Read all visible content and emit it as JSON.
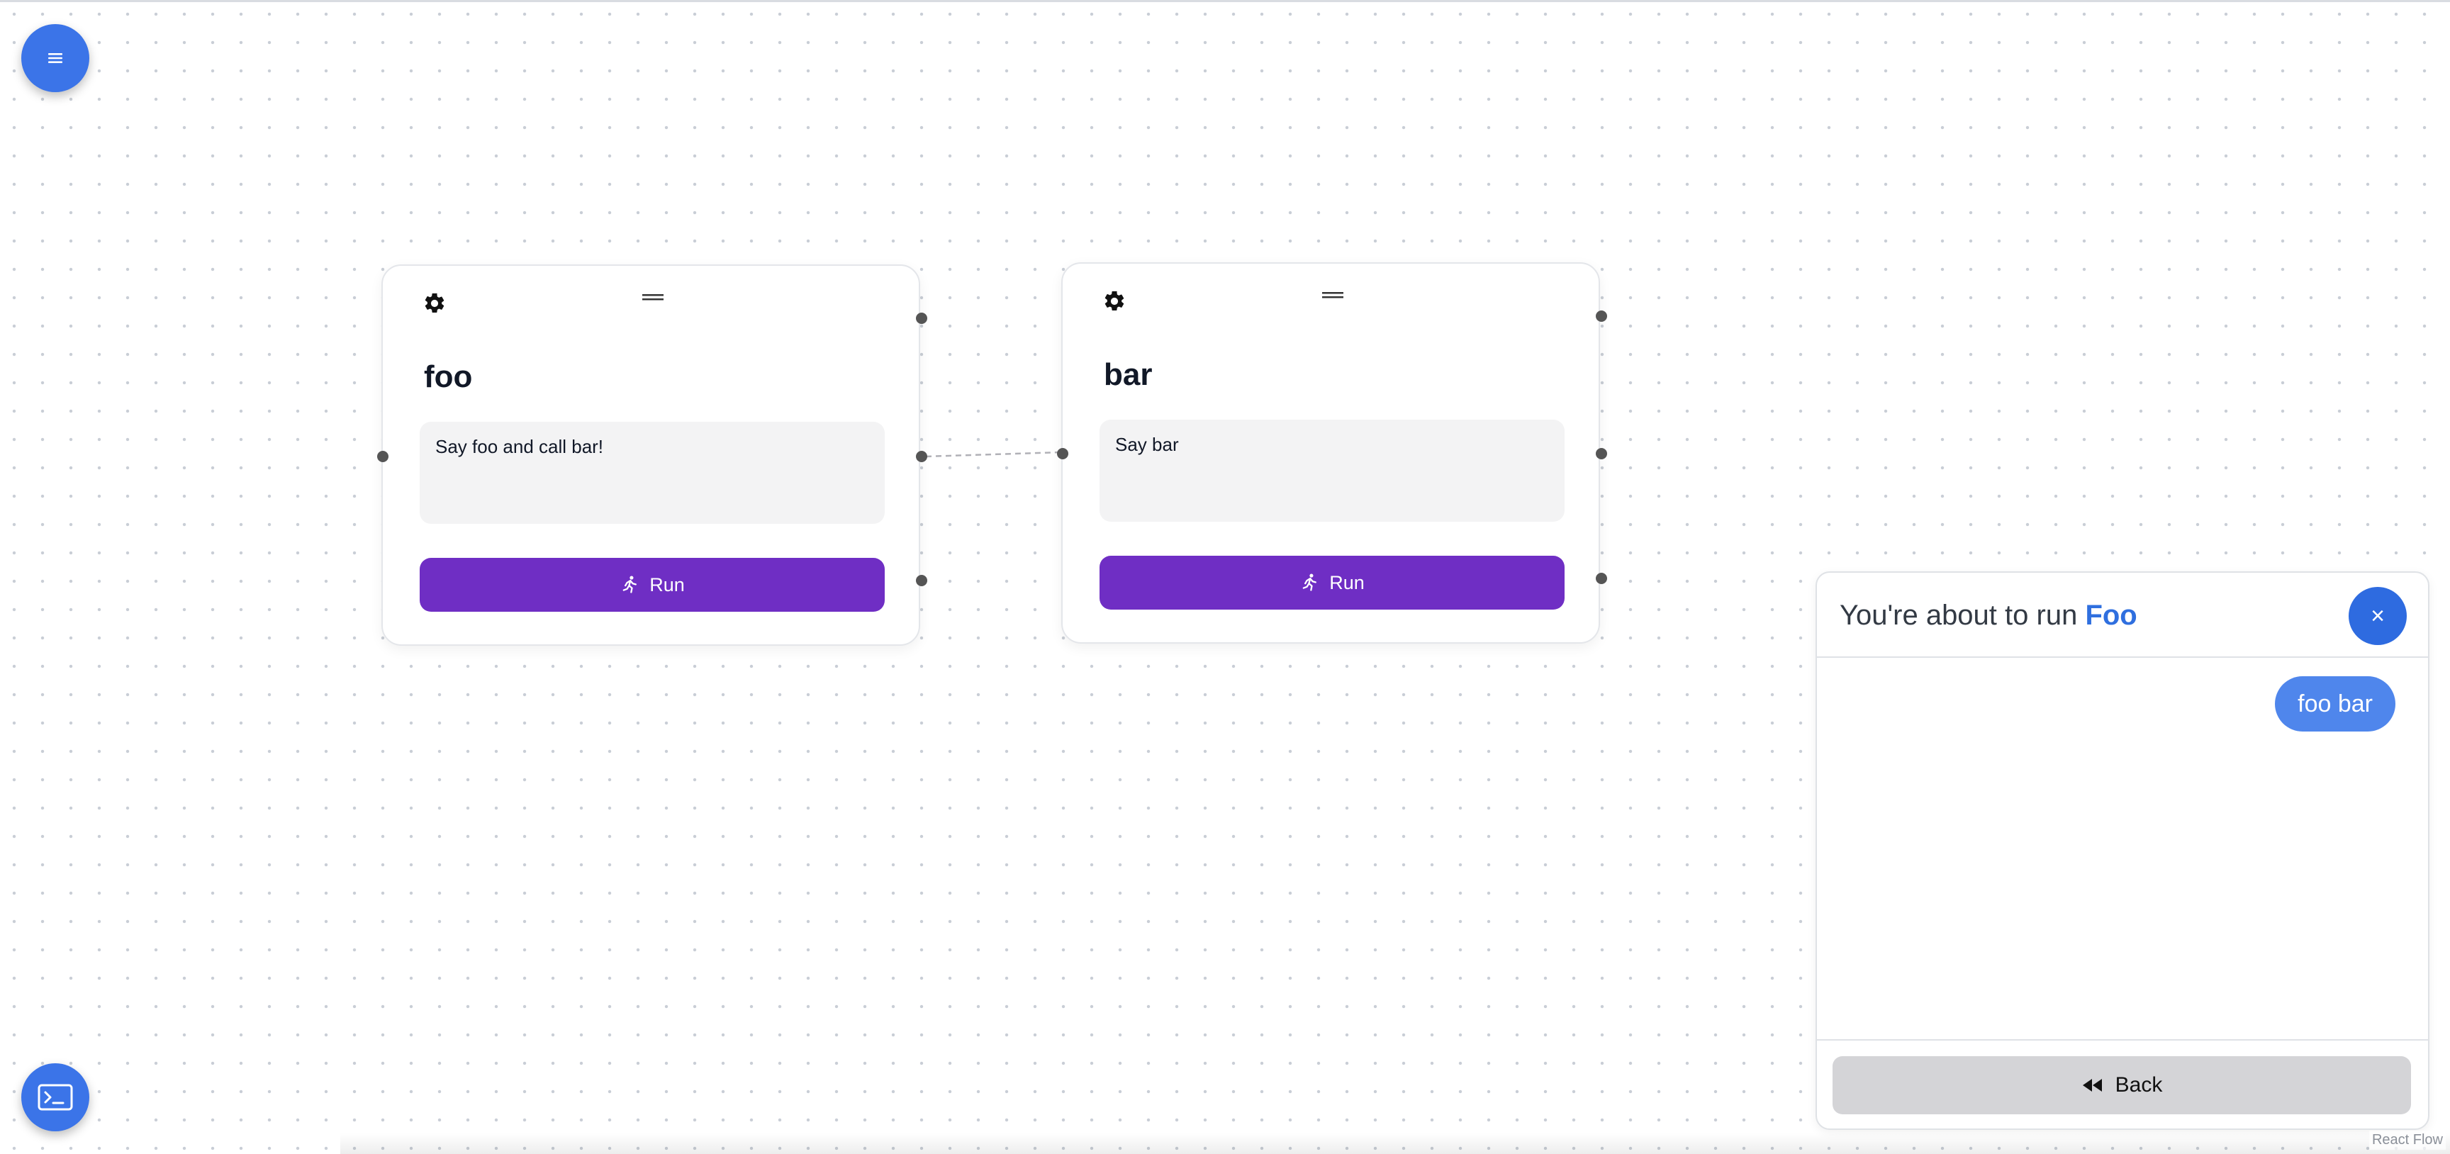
{
  "canvas": {
    "attribution": "React Flow"
  },
  "nodes": [
    {
      "title": "foo",
      "prompt": "Say foo and call bar!",
      "run_label": "Run"
    },
    {
      "title": "bar",
      "prompt": "Say bar",
      "run_label": "Run"
    }
  ],
  "run_panel": {
    "title_prefix": "You're about to run ",
    "title_target": "Foo",
    "close_label": "×",
    "message": "foo bar",
    "back_label": "Back"
  },
  "icons": {
    "menu": "hamburger-icon",
    "terminal": "terminal-icon",
    "settings": "gear-icon",
    "drag": "drag-handle-icon",
    "run": "running-person-icon",
    "back": "rewind-icon"
  },
  "colors": {
    "accent_blue": "#3b74e8",
    "run_purple": "#6f2ec4",
    "bubble_blue": "#4f86ec",
    "back_gray": "#d4d4d7"
  }
}
